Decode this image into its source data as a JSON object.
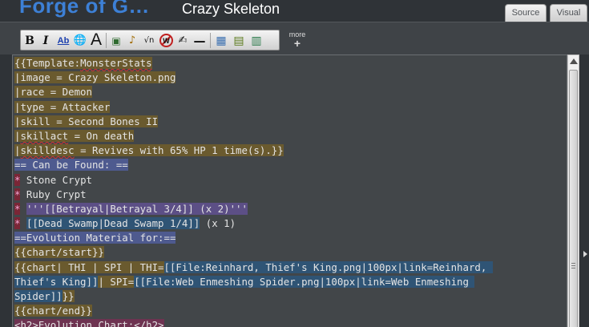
{
  "header": {
    "site_title": "Forge of G…",
    "page_title": "Crazy Skeleton"
  },
  "tabs": [
    {
      "label": "Source"
    },
    {
      "label": "Visual"
    }
  ],
  "toolbar": {
    "buttons": [
      {
        "icon": "bold-icon",
        "glyph": "B"
      },
      {
        "icon": "italic-icon",
        "glyph": "I"
      },
      {
        "icon": "internal-link-icon",
        "glyph": "Ab"
      },
      {
        "icon": "external-link-icon",
        "glyph": "🌐"
      },
      {
        "icon": "heading-icon",
        "glyph": "A"
      },
      {
        "icon": "embedded-file-icon",
        "glyph": "▣"
      },
      {
        "icon": "media-link-icon",
        "glyph": "♪"
      },
      {
        "icon": "math-icon",
        "glyph": "√n"
      },
      {
        "icon": "nowiki-icon",
        "glyph": "W"
      },
      {
        "icon": "signature-icon",
        "glyph": "✍"
      },
      {
        "icon": "horizontal-line-icon",
        "glyph": "—"
      },
      {
        "icon": "gallery-icon",
        "glyph": "▦"
      },
      {
        "icon": "insert-template-icon",
        "glyph": "▤"
      },
      {
        "icon": "insert-table-icon",
        "glyph": "▥"
      }
    ],
    "more_label": "more",
    "more_plus": "+"
  },
  "editor": {
    "lines": [
      {
        "segments": [
          {
            "text": "{{Template:",
            "cls": "tpl-bg"
          },
          {
            "text": "MonsterStats",
            "cls": "tpl-bg sq"
          }
        ]
      },
      {
        "segments": [
          {
            "text": "|image = Crazy Skeleton.png",
            "cls": "tpl-bg"
          }
        ]
      },
      {
        "segments": [
          {
            "text": "|race = Demon",
            "cls": "tpl-bg"
          }
        ]
      },
      {
        "segments": [
          {
            "text": "|type = Attacker",
            "cls": "tpl-bg"
          }
        ]
      },
      {
        "segments": [
          {
            "text": "|skill = Second Bones II",
            "cls": "tpl-bg"
          }
        ]
      },
      {
        "segments": [
          {
            "text": "|",
            "cls": "tpl-bg"
          },
          {
            "text": "skillact",
            "cls": "tpl-bg sq"
          },
          {
            "text": " = On death",
            "cls": "tpl-bg"
          }
        ]
      },
      {
        "segments": [
          {
            "text": "|",
            "cls": "tpl-bg"
          },
          {
            "text": "skilldesc",
            "cls": "tpl-bg sq"
          },
          {
            "text": " = Revives with 65% HP 1 time(s).}}",
            "cls": "tpl-bg"
          }
        ]
      },
      {
        "segments": [
          {
            "text": "== Can be Found: ==",
            "cls": "head-bg"
          }
        ]
      },
      {
        "segments": [
          {
            "text": "*",
            "cls": "red-bg mag"
          },
          {
            "text": " Stone Crypt",
            "cls": ""
          }
        ]
      },
      {
        "segments": [
          {
            "text": "*",
            "cls": "red-bg mag"
          },
          {
            "text": " Ruby Crypt",
            "cls": ""
          }
        ]
      },
      {
        "segments": [
          {
            "text": "*",
            "cls": "red-bg mag"
          },
          {
            "text": " ",
            "cls": ""
          },
          {
            "text": "'''[[Betrayal|Betrayal 3/4]] ",
            "cls": "purple-bg"
          },
          {
            "text": "(x 2)'''",
            "cls": "purple-bg"
          }
        ]
      },
      {
        "segments": [
          {
            "text": "*",
            "cls": "red-bg mag"
          },
          {
            "text": " ",
            "cls": ""
          },
          {
            "text": "[[Dead Swamp|Dead Swamp 1/4]]",
            "cls": "blue-bg"
          },
          {
            "text": " (x 1)",
            "cls": ""
          }
        ]
      },
      {
        "segments": [
          {
            "text": "==Evolution Material for:==",
            "cls": "head-bg"
          }
        ]
      },
      {
        "segments": [
          {
            "text": "{{chart/start}}",
            "cls": "tpl-bg"
          }
        ]
      },
      {
        "segments": [
          {
            "text": "{{chart| THI | SPI | THI=",
            "cls": "tpl-bg"
          },
          {
            "text": "[[File:Reinhard, Thief's King.png|100px|link=Reinhard, ",
            "cls": "blue-bg"
          }
        ]
      },
      {
        "segments": [
          {
            "text": "Thief's King]]",
            "cls": "blue-bg"
          },
          {
            "text": "| SPI=",
            "cls": "tpl-bg"
          },
          {
            "text": "[[File:Web Enmeshing Spider.png|100px|link=Web Enmeshing ",
            "cls": "blue-bg"
          }
        ]
      },
      {
        "segments": [
          {
            "text": "Spider]]",
            "cls": "blue-bg"
          },
          {
            "text": "}}",
            "cls": "tpl-bg"
          }
        ]
      },
      {
        "segments": [
          {
            "text": "{{chart/end}}",
            "cls": "tpl-bg"
          }
        ]
      },
      {
        "segments": [
          {
            "text": "<h2>Evolution Chart:</h2>",
            "cls": "h2-bg"
          }
        ]
      }
    ]
  }
}
